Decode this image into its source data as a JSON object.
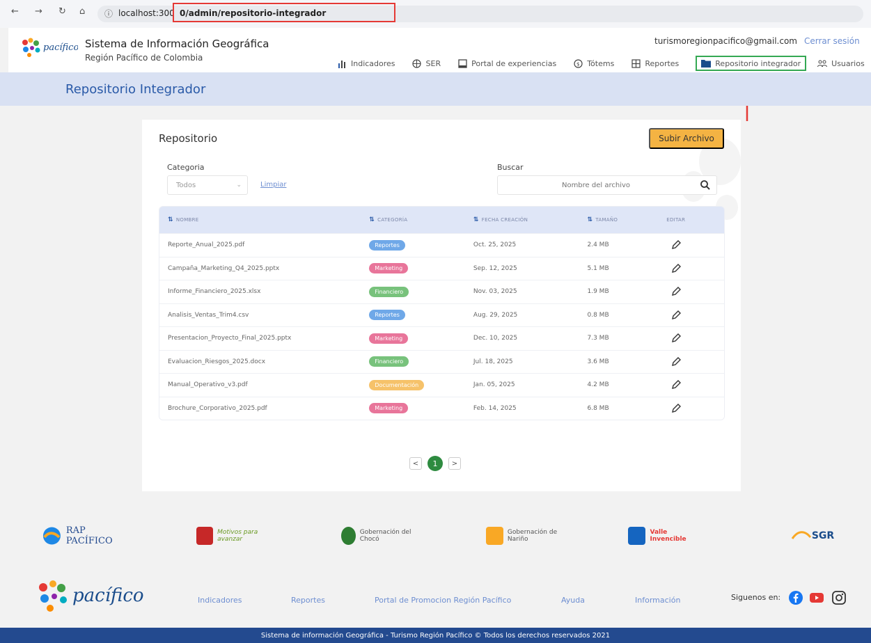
{
  "browser": {
    "host": "localhost:300",
    "path": "0/admin/repositorio-integrador"
  },
  "header": {
    "title": "Sistema de Información Geográfica",
    "subtitle": "Región Pacífico de Colombia",
    "email": "turismoregionpacifico@gmail.com",
    "logout": "Cerrar sesión",
    "menu": [
      {
        "label": "Indicadores",
        "icon": "bar-chart-icon"
      },
      {
        "label": "SER",
        "icon": "cube-icon"
      },
      {
        "label": "Portal de experiencias",
        "icon": "window-icon"
      },
      {
        "label": "Tótems",
        "icon": "coin-icon"
      },
      {
        "label": "Reportes",
        "icon": "grid-icon"
      },
      {
        "label": "Repositorio integrador",
        "icon": "folder-icon",
        "active": true
      },
      {
        "label": "Usuarios",
        "icon": "users-icon"
      }
    ]
  },
  "section": {
    "title": "Repositorio Integrador"
  },
  "card": {
    "title": "Repositorio",
    "upload_label": "Subir Archivo",
    "category_label": "Categoria",
    "category_value": "Todos",
    "clear_label": "Limpiar",
    "search_label": "Buscar",
    "search_placeholder": "Nombre del archivo"
  },
  "table": {
    "headers": [
      "NOMBRE",
      "CATEGORÍA",
      "FECHA CREACIÓN",
      "TAMAÑO",
      "EDITAR"
    ],
    "rows": [
      {
        "name": "Reporte_Anual_2025.pdf",
        "category": "Reportes",
        "date": "Oct. 25, 2025",
        "size": "2.4 MB"
      },
      {
        "name": "Campaña_Marketing_Q4_2025.pptx",
        "category": "Marketing",
        "date": "Sep. 12, 2025",
        "size": "5.1 MB"
      },
      {
        "name": "Informe_Financiero_2025.xlsx",
        "category": "Financiero",
        "date": "Nov. 03, 2025",
        "size": "1.9 MB"
      },
      {
        "name": "Analisis_Ventas_Trim4.csv",
        "category": "Reportes",
        "date": "Aug. 29, 2025",
        "size": "0.8 MB"
      },
      {
        "name": "Presentacion_Proyecto_Final_2025.pptx",
        "category": "Marketing",
        "date": "Dec. 10, 2025",
        "size": "7.3 MB"
      },
      {
        "name": "Evaluacion_Riesgos_2025.docx",
        "category": "Financiero",
        "date": "Jul. 18, 2025",
        "size": "3.6 MB"
      },
      {
        "name": "Manual_Operativo_v3.pdf",
        "category": "Documentación",
        "date": "Jan. 05, 2025",
        "size": "4.2 MB"
      },
      {
        "name": "Brochure_Corporativo_2025.pdf",
        "category": "Marketing",
        "date": "Feb. 14, 2025",
        "size": "6.8 MB"
      }
    ]
  },
  "category_colors": {
    "Reportes": "#6fa8e8",
    "Marketing": "#e8759a",
    "Financiero": "#78c27c",
    "Documentación": "#f6c26a"
  },
  "pagination": {
    "prev": "<",
    "current": "1",
    "next": ">"
  },
  "sponsors": [
    {
      "name": "RAP PACÍFICO"
    },
    {
      "name": "Motivos para avanzar"
    },
    {
      "name": "Gobernación del Chocó"
    },
    {
      "name": "Gobernación de Nariño"
    },
    {
      "name": "Valle Invencible"
    },
    {
      "name": "SGR"
    }
  ],
  "footer": {
    "links": [
      "Indicadores",
      "Reportes",
      "Portal de Promocion Región Pacífico",
      "Ayuda",
      "Información"
    ],
    "follow": "Siguenos en:",
    "copyright": "Sistema de información Geográfica - Turismo Región Pacífico © Todos los derechos reservados 2021"
  },
  "colors": {
    "accent": "#2a5aa8",
    "upload": "#f4b343",
    "active_border": "#34a853",
    "footer_bar": "#234a8f"
  }
}
